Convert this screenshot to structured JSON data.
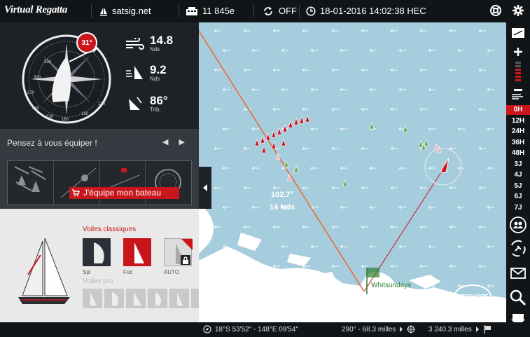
{
  "app": {
    "logo": "Virtual Regatta",
    "site": "satsig.net"
  },
  "header": {
    "credits": "11 845e",
    "sync": "OFF",
    "datetime": "18-01-2016 14:02:38 HEC"
  },
  "instruments": {
    "heading_badge": "31°",
    "compass_ticks": [
      "330",
      "300",
      "270",
      "240",
      "210",
      "180",
      "150",
      "120"
    ],
    "wind_speed": "14.8",
    "wind_unit": "Nds",
    "boat_speed": "9.2",
    "boat_unit": "Nds",
    "twa": "86°",
    "twa_unit": "Trib."
  },
  "equip": {
    "title": "Pensez à vous équiper !",
    "arrows": "◀ ▶",
    "button": "J'équipe mon bateau"
  },
  "sails": {
    "classic_title": "Voiles classiques",
    "items": [
      {
        "label": "Spi"
      },
      {
        "label": "Foc"
      },
      {
        "label": "AUTO"
      }
    ],
    "pro_title": "Voiles pro"
  },
  "map": {
    "wind_readout": "102.7°",
    "wind_speed_readout": "14 Nds",
    "place": "Whitsundays",
    "badge": "OFFSHORE"
  },
  "timeline": {
    "active": "0H",
    "items": [
      "0H",
      "12H",
      "24H",
      "36H",
      "48H",
      "3J",
      "4J",
      "5J",
      "6J",
      "7J"
    ]
  },
  "status": {
    "position": "18°S 53'52\" - 148°E 09'54\"",
    "bearing": "290° - 68.3 milles",
    "distance": "3 240.3 milles"
  },
  "colors": {
    "accent": "#c9161d",
    "sea": "#a6cddd",
    "land": "#ffffff",
    "panel": "#1d2227"
  }
}
